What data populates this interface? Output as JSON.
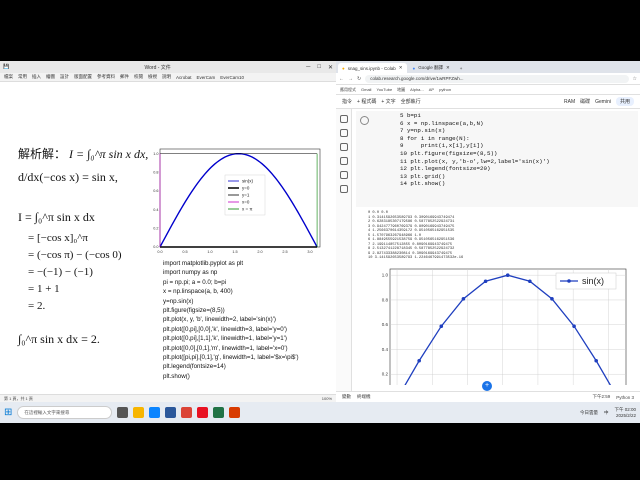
{
  "word": {
    "window_title": "Word - 文件",
    "menu": [
      "檔案",
      "常用",
      "插入",
      "繪圖",
      "設計",
      "版面配置",
      "參考資料",
      "郵件",
      "校閱",
      "檢視",
      "說明",
      "Acrobat",
      "EverCam",
      "EverCam10"
    ],
    "status_text": "第 1 頁，共 1 頁",
    "zoom": "100%",
    "math": {
      "title": "解析解：",
      "title_expr": "I = ∫₀^π sin x dx,",
      "deriv": "d/dx(−cos x) = sin x,",
      "int": "I = ∫₀^π sin x dx",
      "steps": [
        "= [−cos x]₀^π",
        "= (−cos π) − (−cos 0)",
        "= −(−1) − (−1)",
        "= 1 + 1",
        "= 2."
      ],
      "final": "∫₀^π sin x dx = 2."
    },
    "code_lines": [
      "import matplotlib.pyplot as plt",
      "import numpy as np",
      "pi = np.pi; a = 0.0; b=pi",
      "x = np.linspace(a, b, 400)",
      "y=np.sin(x)",
      "plt.figure(figsize=(8,5))",
      "plt.plot(x, y, 'b', linewidth=2, label='sin(x)')",
      "plt.plot([0,pi],[0,0],'k', linewidth=3, label='y=0')",
      "plt.plot([0,pi],[1,1],'k', linewidth=1, label='y=1')",
      "plt.plot([0,0],[0,1],'m', linewidth=1, label='x=0')",
      "plt.plot([pi,pi],[0,1],'g', linewidth=1, label='$x=\\pi$')",
      "plt.legend(fontsize=14)",
      "plt.show()"
    ],
    "plot_legend": [
      "sin(x)",
      "y=0",
      "y=1",
      "x=0",
      "x = π"
    ],
    "plot_xticks": [
      "0.0",
      "0.5",
      "1.0",
      "1.5",
      "2.0",
      "2.5",
      "3.0"
    ],
    "plot_yticks": [
      "0.0",
      "0.2",
      "0.4",
      "0.6",
      "0.8",
      "1.0"
    ]
  },
  "colab": {
    "tabs": [
      "snag_sins.ipynb - Colab",
      "Google 翻譯"
    ],
    "url": "colab.research.google.com/drive/1wRPFZwh...",
    "bookmarks": [
      "應用程式",
      "Gmail",
      "YouTube",
      "地圖",
      "Alpha...",
      "AP",
      "python"
    ],
    "toolbar": [
      "指令",
      "+ 程式碼",
      "+ 文字",
      "全部執行"
    ],
    "toolbar_right": [
      "RAM",
      "磁碟"
    ],
    "gemini": "Gemini",
    "share": "共用",
    "code_lines": [
      "5 b=pi",
      "6 x = np.linspace(a,b,N)",
      "7 y=np.sin(x)",
      "8 for i in range(N):",
      "9     print(i,x[i],y[i])",
      "10 plt.figure(figsize=(8,5))",
      "11 plt.plot(x, y,'b-o',lw=2,label='sin(x)')",
      "12 plt.legend(fontsize=20)",
      "13 plt.grid()",
      "14 plt.show()"
    ],
    "output_lines": [
      "0 0.0 0.0",
      "1 0.3141592653589793 0.3090169943749474",
      "2 0.6283185307179586 0.5877852522924731",
      "3 0.9424777960769379 0.8090169943749475",
      "4 1.2566370614359172 0.9510565162951535",
      "5 1.5707963267948966 1.0",
      "6 1.8849555921538759 0.9510565162951536",
      "7 2.199114857512855 0.8090169943749475",
      "8 2.5132741228718345 0.5877852522924732",
      "9 2.827433388230814 0.3090169943749475",
      "10 3.141592653589793 1.2246467991473532e-16"
    ],
    "output_legend": "sin(x)",
    "output_yticks": [
      "1.0",
      "0.8",
      "0.6",
      "0.4",
      "0.2"
    ],
    "status_left": [
      "變數",
      "終端機"
    ],
    "status_right": [
      "下午2:59",
      "Python 3"
    ]
  },
  "taskbar": {
    "search_placeholder": "在這裡輸入文字來搜尋",
    "weather": "今日雲量",
    "time": "下午 02:00",
    "date": "2025/2/22",
    "tray": "中"
  },
  "chart_data": [
    {
      "type": "line",
      "x": [
        0.0,
        0.314,
        0.628,
        0.942,
        1.257,
        1.571,
        1.885,
        2.199,
        2.513,
        2.827,
        3.142
      ],
      "series": [
        {
          "name": "sin(x)",
          "values": [
            0.0,
            0.309,
            0.588,
            0.809,
            0.951,
            1.0,
            0.951,
            0.809,
            0.588,
            0.309,
            0.0
          ]
        },
        {
          "name": "y=0",
          "values": [
            0,
            0
          ]
        },
        {
          "name": "y=1",
          "values": [
            1,
            1
          ]
        },
        {
          "name": "x=0",
          "values": [
            0,
            1
          ]
        },
        {
          "name": "x = π",
          "values": [
            0,
            1
          ]
        }
      ],
      "xlim": [
        0,
        3.2
      ],
      "ylim": [
        0,
        1.05
      ],
      "legend": "center"
    },
    {
      "type": "line",
      "x": [
        0.0,
        0.314,
        0.628,
        0.942,
        1.257,
        1.571,
        1.885,
        2.199,
        2.513,
        2.827,
        3.142
      ],
      "series": [
        {
          "name": "sin(x)",
          "values": [
            0.0,
            0.309,
            0.588,
            0.809,
            0.951,
            1.0,
            0.951,
            0.809,
            0.588,
            0.309,
            0.0
          ]
        }
      ],
      "ylim": [
        0,
        1.05
      ],
      "grid": true,
      "legend": "top-right"
    }
  ]
}
